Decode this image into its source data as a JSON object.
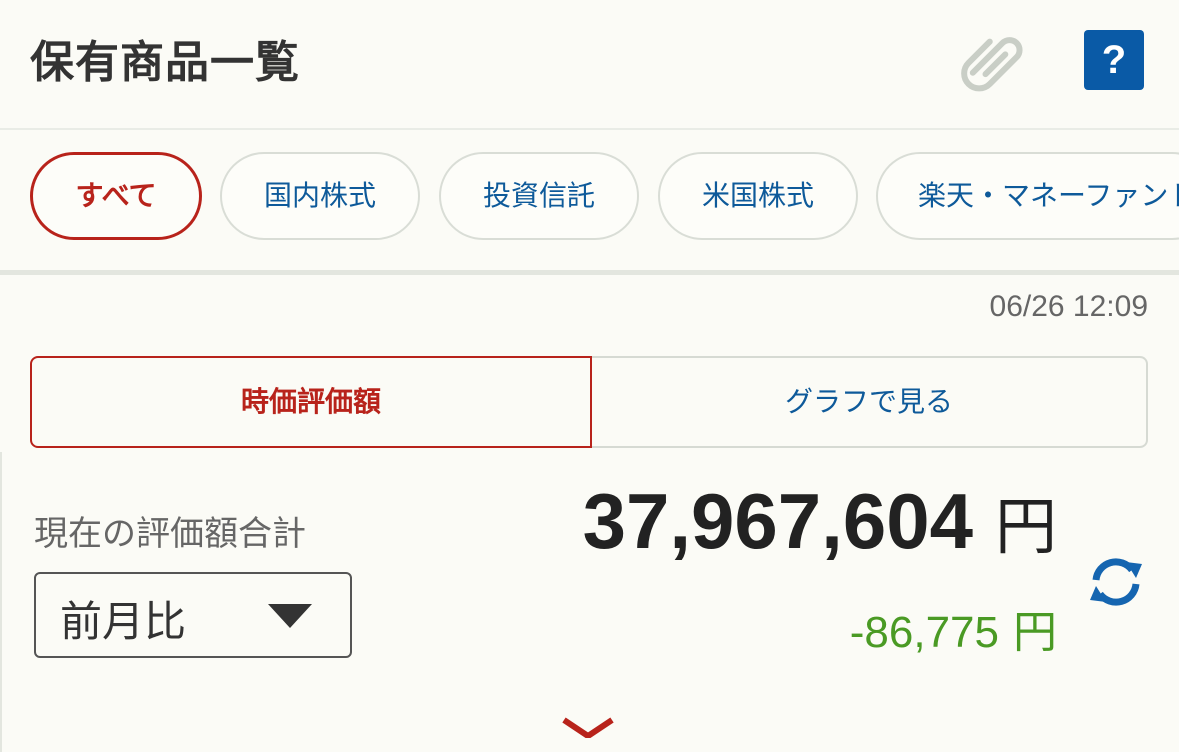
{
  "header": {
    "title": "保有商品一覧",
    "help_label": "?"
  },
  "tabs": [
    {
      "label": "すべて",
      "active": true
    },
    {
      "label": "国内株式",
      "active": false
    },
    {
      "label": "投資信託",
      "active": false
    },
    {
      "label": "米国株式",
      "active": false
    },
    {
      "label": "楽天・マネーファンド",
      "active": false
    }
  ],
  "timestamp": "06/26 12:09",
  "view_toggle": {
    "valuation_label": "時価評価額",
    "graph_label": "グラフで見る"
  },
  "summary": {
    "total_label": "現在の評価額合計",
    "total_value": "37,967,604",
    "total_unit": "円",
    "compare_selected": "前月比",
    "change_value": "-86,775",
    "change_unit": "円"
  },
  "colors": {
    "accent_red": "#b8231b",
    "link_blue": "#0e5a9a",
    "negative_green": "#4a9a24",
    "help_blue": "#0a5aa6"
  },
  "icons": {
    "clip": "paperclip-icon",
    "help": "help-icon",
    "refresh": "refresh-icon",
    "dropdown": "triangle-down-icon"
  }
}
